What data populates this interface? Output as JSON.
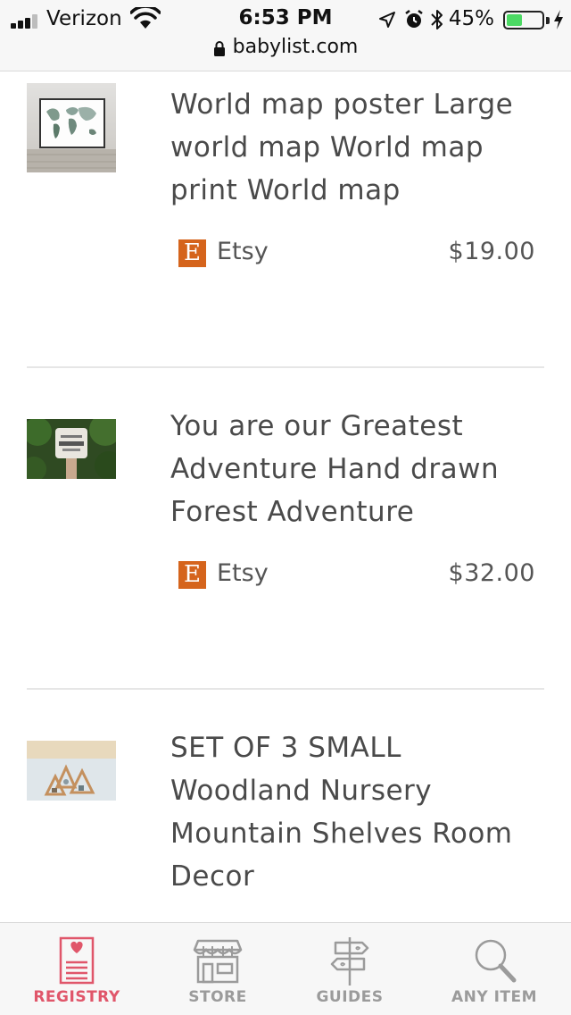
{
  "status_bar": {
    "carrier": "Verizon",
    "time": "6:53 PM",
    "battery_percent": "45%",
    "battery_level": 0.45,
    "url": "babylist.com"
  },
  "items": [
    {
      "title": "World map poster Large world map World map print World map",
      "store_badge": "E",
      "store": "Etsy",
      "price": "$19.00"
    },
    {
      "title": "You are our Greatest Adventure Hand drawn Forest Adventure",
      "store_badge": "E",
      "store": "Etsy",
      "price": "$32.00"
    },
    {
      "title": "SET OF 3 SMALL Woodland Nursery Mountain Shelves Room Decor"
    }
  ],
  "tabs": [
    {
      "label": "REGISTRY",
      "icon": "registry-icon",
      "active": true
    },
    {
      "label": "STORE",
      "icon": "store-icon",
      "active": false
    },
    {
      "label": "GUIDES",
      "icon": "signpost-icon",
      "active": false
    },
    {
      "label": "ANY ITEM",
      "icon": "search-icon",
      "active": false
    }
  ],
  "colors": {
    "accent": "#e0566a",
    "etsy": "#d5641c",
    "battery": "#4cd964",
    "inactive_tab": "#9b9b9b"
  }
}
